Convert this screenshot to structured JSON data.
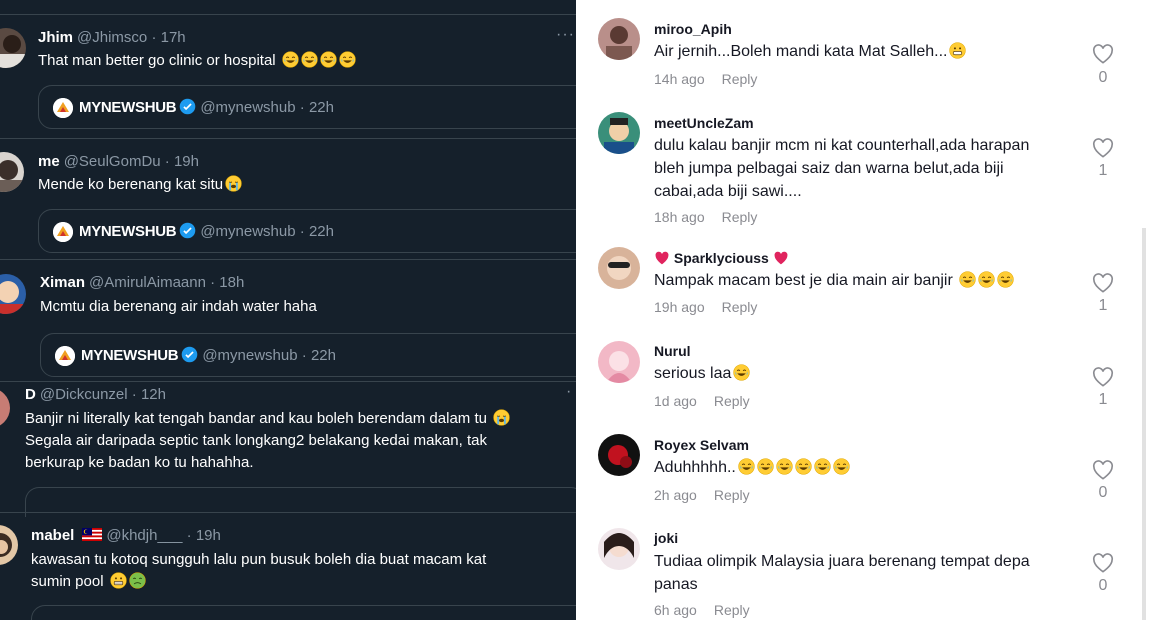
{
  "tweets": [
    {
      "name": "Jhim",
      "handle": "@Jhimsco",
      "time": "17h",
      "text": "That man better go clinic or hospital",
      "emoji": [
        "joy",
        "joy",
        "joy",
        "joy"
      ],
      "quote": {
        "name": "MYNEWSHUB",
        "handle": "@mynewshub",
        "time": "22h"
      }
    },
    {
      "name": "me",
      "handle": "@SeulGomDu",
      "time": "19h",
      "text": "Mende ko berenang kat situ",
      "emoji": [
        "sob"
      ],
      "quote": {
        "name": "MYNEWSHUB",
        "handle": "@mynewshub",
        "time": "22h"
      }
    },
    {
      "name": "Ximan",
      "handle": "@AmirulAimaann",
      "time": "18h",
      "text": "Mcmtu dia berenang air indah water haha",
      "emoji": [],
      "quote": {
        "name": "MYNEWSHUB",
        "handle": "@mynewshub",
        "time": "22h"
      }
    },
    {
      "name": "D",
      "handle": "@Dickcunzel",
      "time": "12h",
      "lines": [
        "Banjir ni literally kat tengah bandar and kau boleh berendam dalam tu",
        "Segala air daripada septic tank longkang2 belakang kedai makan, tak",
        "berkurap ke badan ko tu hahahha."
      ],
      "emoji": [
        "sob"
      ]
    },
    {
      "name": "mabel",
      "handle": "@khdjh___",
      "time": "19h",
      "lines": [
        "kawasan tu kotoq sungguh lalu pun busuk boleh dia buat macam kat",
        "sumin pool"
      ],
      "emoji": [
        "grimace",
        "nauseated"
      ]
    }
  ],
  "separator": "·",
  "more_icon": "more-horizontal-icon",
  "comments": [
    {
      "user": "miroo_Apih",
      "text": "Air jernih...Boleh mandi kata Mat Salleh...",
      "emoji": [
        "grin"
      ],
      "time": "14h ago",
      "reply": "Reply",
      "likes": "0"
    },
    {
      "user": "meetUncleZam",
      "lines": [
        "dulu kalau banjir mcm ni kat counterhall,ada harapan",
        "bleh jumpa pelbagai saiz dan warna belut,ada biji",
        "cabai,ada biji sawi...."
      ],
      "time": "18h ago",
      "reply": "Reply",
      "likes": "1"
    },
    {
      "user": "Sparklyciouss",
      "text": "Nampak macam best je dia main air banjir",
      "emoji": [
        "joy",
        "joy",
        "joy"
      ],
      "time": "19h ago",
      "reply": "Reply",
      "likes": "1"
    },
    {
      "user": "Nurul",
      "text": "serious laa",
      "emoji": [
        "rofl"
      ],
      "time": "1d ago",
      "reply": "Reply",
      "likes": "1"
    },
    {
      "user": "Royex Selvam",
      "text": "Aduhhhhh..",
      "emoji": [
        "rofl",
        "rofl",
        "rofl",
        "rofl",
        "rofl",
        "rofl"
      ],
      "time": "2h ago",
      "reply": "Reply",
      "likes": "0"
    },
    {
      "user": "joki",
      "lines": [
        "Tudiaa olimpik Malaysia juara berenang tempat depa",
        "panas"
      ],
      "time": "6h ago",
      "reply": "Reply",
      "likes": "0"
    }
  ],
  "colors": {
    "dark_bg": "#15202b",
    "verified": "#1d9bf0",
    "heart_red": "#e0245e"
  }
}
